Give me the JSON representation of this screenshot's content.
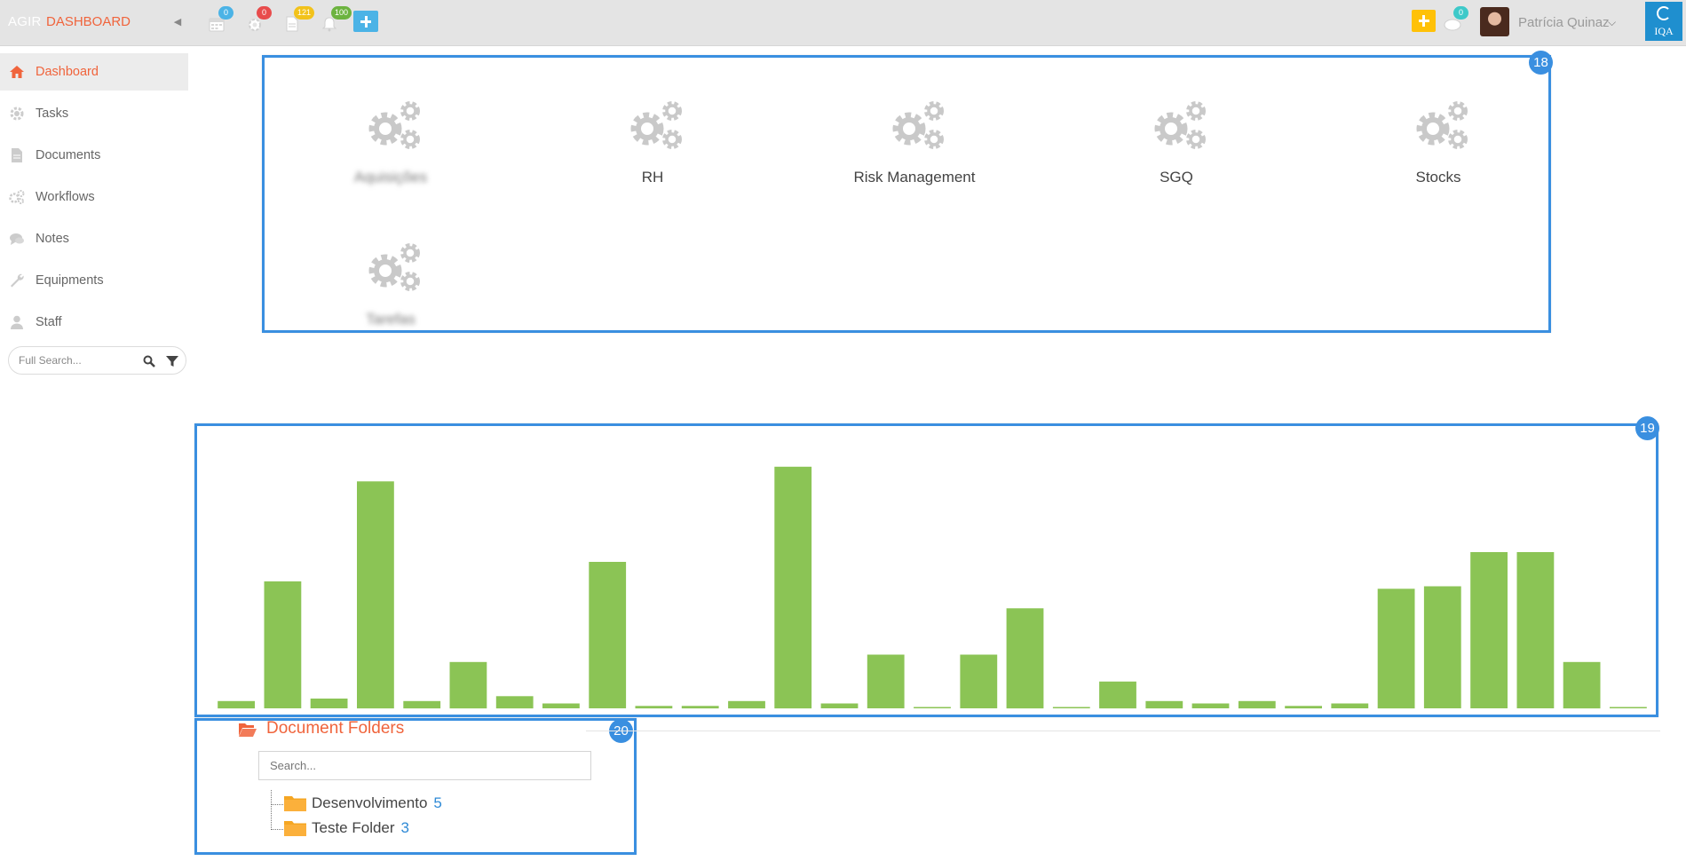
{
  "topbar": {
    "brand_agir": "AGIR",
    "brand_dashboard": "DASHBOARD",
    "badges": {
      "calendar": "0",
      "settings": "0",
      "documents": "121",
      "notifications": "100",
      "messages": "0"
    },
    "badge_colors": {
      "calendar": "#4bb3e6",
      "settings": "#e84c4c",
      "documents": "#f2c21b",
      "notifications": "#6cb33f",
      "messages": "#3ec9c9"
    },
    "user_name": "Patrícia Quinaz",
    "logo_text": "IQA"
  },
  "sidebar": {
    "items": [
      {
        "label": "Dashboard",
        "icon": "home-icon",
        "active": true
      },
      {
        "label": "Tasks",
        "icon": "gear-icon"
      },
      {
        "label": "Documents",
        "icon": "document-icon"
      },
      {
        "label": "Workflows",
        "icon": "gears-icon"
      },
      {
        "label": "Notes",
        "icon": "comments-icon"
      },
      {
        "label": "Equipments",
        "icon": "wrench-icon"
      },
      {
        "label": "Staff",
        "icon": "user-icon"
      }
    ],
    "search_placeholder": "Full Search..."
  },
  "widgets": {
    "apps_number": "18",
    "chart_number": "19",
    "folders_number": "20"
  },
  "modules": [
    {
      "label": "Aquisições",
      "blurred": true
    },
    {
      "label": "RH"
    },
    {
      "label": "Risk Management"
    },
    {
      "label": "SGQ"
    },
    {
      "label": "Stocks"
    },
    {
      "label": "Tarefas",
      "blurred": true
    }
  ],
  "chart_data": {
    "type": "bar",
    "title": "",
    "xlabel": "",
    "ylabel": "",
    "ylim": [
      0,
      100
    ],
    "color": "#8bc455",
    "values": [
      3,
      52,
      4,
      93,
      3,
      19,
      5,
      2,
      60,
      1,
      1,
      3,
      99,
      2,
      22,
      0.5,
      22,
      41,
      0.5,
      11,
      3,
      2,
      3,
      1,
      2,
      49,
      50,
      64,
      64,
      19,
      0.5
    ]
  },
  "folders": {
    "title": "Document Folders",
    "search_placeholder": "Search...",
    "items": [
      {
        "name": "Desenvolvimento",
        "count": "5"
      },
      {
        "name": "Teste Folder",
        "count": "3"
      }
    ]
  }
}
